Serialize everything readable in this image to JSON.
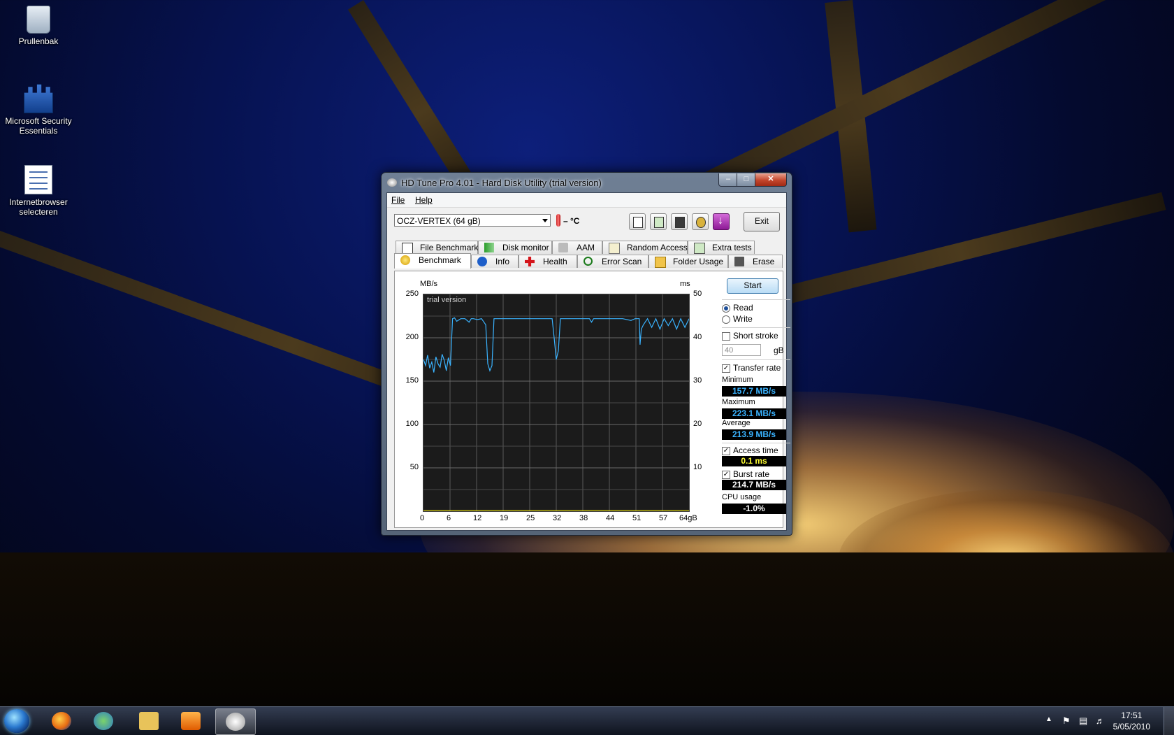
{
  "desktop": {
    "icons": [
      {
        "label": "Prullenbak"
      },
      {
        "label": "Microsoft Security Essentials"
      },
      {
        "label": "Internetbrowser selecteren"
      }
    ]
  },
  "window": {
    "title": "HD Tune Pro 4.01 - Hard Disk Utility (trial version)",
    "menu": {
      "file": "File",
      "help": "Help"
    },
    "toolbar": {
      "drive": "OCZ-VERTEX (64 gB)",
      "temperature": "– °C",
      "exit_label": "Exit",
      "buttons": [
        "copy-text-icon",
        "copy-screenshot-icon",
        "save-icon",
        "options-icon",
        "download-icon"
      ]
    },
    "tabs_top": [
      {
        "label": "File Benchmark",
        "icon": "file-benchmark-icon"
      },
      {
        "label": "Disk monitor",
        "icon": "disk-monitor-icon"
      },
      {
        "label": "AAM",
        "icon": "speaker-icon"
      },
      {
        "label": "Random Access",
        "icon": "random-access-icon"
      },
      {
        "label": "Extra tests",
        "icon": "extra-tests-icon"
      }
    ],
    "tabs_bottom": [
      {
        "label": "Benchmark",
        "icon": "bulb-icon"
      },
      {
        "label": "Info",
        "icon": "info-icon"
      },
      {
        "label": "Health",
        "icon": "health-cross-icon"
      },
      {
        "label": "Error Scan",
        "icon": "magnifier-icon"
      },
      {
        "label": "Folder Usage",
        "icon": "folder-icon"
      },
      {
        "label": "Erase",
        "icon": "trash-icon"
      }
    ],
    "active_tab": "Benchmark",
    "controls": {
      "start_label": "Start",
      "read_label": "Read",
      "write_label": "Write",
      "mode": "Read",
      "short_stroke_label": "Short stroke",
      "short_stroke_checked": false,
      "short_stroke_value": "40",
      "short_stroke_unit": "gB",
      "transfer_rate_label": "Transfer rate",
      "transfer_rate_checked": true,
      "access_time_label": "Access time",
      "access_time_checked": true,
      "burst_rate_label": "Burst rate",
      "burst_rate_checked": true
    },
    "stats": {
      "minimum_label": "Minimum",
      "minimum_value": "157.7 MB/s",
      "maximum_label": "Maximum",
      "maximum_value": "223.1 MB/s",
      "average_label": "Average",
      "average_value": "213.9 MB/s",
      "access_time_value": "0.1 ms",
      "burst_rate_value": "214.7 MB/s",
      "cpu_label": "CPU usage",
      "cpu_value": "-1.0%",
      "value_color_blue": "#3ab3ff",
      "value_color_yellow": "#ffff33",
      "value_color_white": "#ffffff"
    }
  },
  "chart_data": {
    "type": "line",
    "watermark": "trial version",
    "y_left_label": "MB/s",
    "y_right_label": "ms",
    "y_left_ticks": [
      "250",
      "200",
      "150",
      "100",
      "50"
    ],
    "y_right_ticks": [
      "50",
      "40",
      "30",
      "20",
      "10"
    ],
    "x_ticks": [
      "0",
      "6",
      "12",
      "19",
      "25",
      "32",
      "38",
      "44",
      "51",
      "57",
      "64gB"
    ],
    "ylim": [
      0,
      250
    ],
    "xlim": [
      0,
      64
    ],
    "series": [
      {
        "color": "#3ab3ff",
        "x": [
          0,
          0.5,
          1,
          1.5,
          2,
          2.5,
          3,
          3.5,
          4,
          4.5,
          5,
          5.5,
          6,
          6.5,
          7,
          7.5,
          8,
          9,
          10,
          11,
          11.5,
          12,
          13,
          14,
          15,
          15.5,
          16,
          16.5,
          17,
          18,
          20,
          22,
          24,
          26,
          28,
          30,
          31,
          31.5,
          32,
          32.5,
          33,
          34,
          36,
          38,
          40,
          40.5,
          41,
          42,
          44,
          46,
          48,
          50,
          51,
          52,
          52.2,
          52.5,
          53,
          54,
          55,
          56,
          57,
          58,
          59,
          60,
          61,
          62,
          63,
          64
        ],
        "y": [
          175,
          168,
          180,
          165,
          172,
          160,
          178,
          170,
          166,
          181,
          174,
          162,
          177,
          168,
          222,
          223,
          219,
          222,
          222,
          218,
          222,
          222,
          221,
          222,
          215,
          170,
          162,
          168,
          222,
          222,
          222,
          222,
          222,
          222,
          222,
          222,
          222,
          200,
          175,
          185,
          222,
          222,
          222,
          222,
          222,
          218,
          222,
          222,
          222,
          222,
          222,
          220,
          222,
          222,
          192,
          210,
          215,
          222,
          212,
          222,
          210,
          222,
          214,
          222,
          210,
          222,
          212,
          222
        ]
      },
      {
        "color": "#e8e010",
        "x": [
          0,
          64
        ],
        "y": [
          1,
          1
        ]
      }
    ]
  },
  "taskbar": {
    "clock_time": "17:51",
    "clock_date": "5/05/2010",
    "items": [
      "start-orb",
      "firefox-icon",
      "messenger-icon",
      "explorer-icon",
      "media-player-icon",
      "hdtune-icon"
    ]
  }
}
